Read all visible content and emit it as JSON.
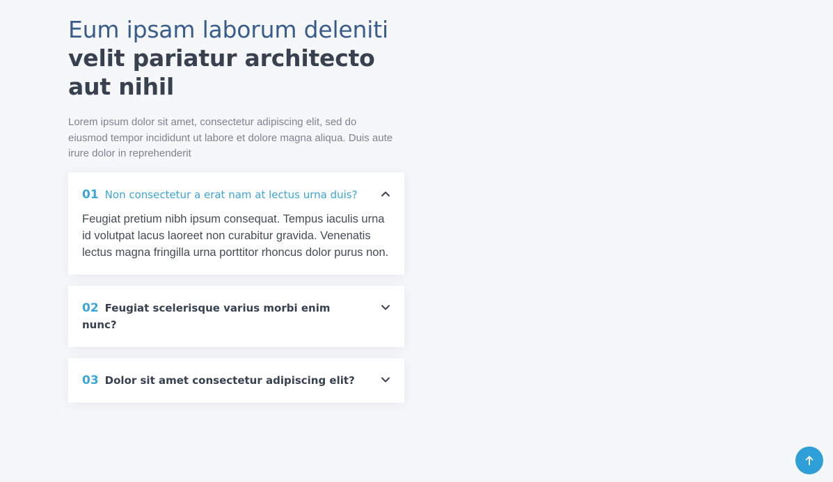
{
  "hero": {
    "title_light": "Eum ipsam laborum deleniti",
    "title_bold": "velit pariatur architecto aut nihil",
    "intro": "Lorem ipsum dolor sit amet, consectetur adipiscing elit, sed do eiusmod tempor incididunt ut labore et dolore magna aliqua. Duis aute irure dolor in reprehenderit"
  },
  "faq": {
    "items": [
      {
        "number": "01",
        "question": "Non consectetur a erat nam at lectus urna duis?",
        "answer": "Feugiat pretium nibh ipsum consequat. Tempus iaculis urna id volutpat lacus laoreet non curabitur gravida. Venenatis lectus magna fringilla urna porttitor rhoncus dolor purus non.",
        "expanded": true,
        "icon": "chevron-up-icon"
      },
      {
        "number": "02",
        "question": "Feugiat scelerisque varius morbi enim nunc?",
        "expanded": false,
        "icon": "chevron-down-icon"
      },
      {
        "number": "03",
        "question": "Dolor sit amet consectetur adipiscing elit?",
        "expanded": false,
        "icon": "chevron-down-icon"
      }
    ]
  },
  "back_to_top": {
    "icon": "arrow-up-icon"
  },
  "colors": {
    "accent": "#3aa6d8",
    "title_light": "#385c8c",
    "title_bold": "#37414f",
    "background": "#f6f7f9",
    "button": "#2f9fd8"
  }
}
